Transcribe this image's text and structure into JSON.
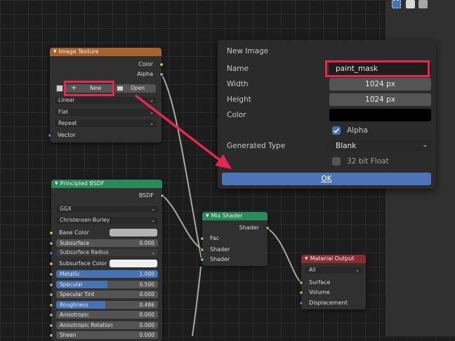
{
  "image_texture": {
    "title": "Image Texture",
    "out_color": "Color",
    "out_alpha": "Alpha",
    "new_label": "New",
    "open_label": "Open",
    "interpolation": "Linear",
    "projection": "Flat",
    "extension": "Repeat",
    "in_vector": "Vector"
  },
  "principled": {
    "title": "Principled BSDF",
    "out_bsdf": "BSDF",
    "distribution": "GGX",
    "subsurface_method": "Christensen-Burley",
    "base_color": "Base Color",
    "base_color_value": "#b4b4b4",
    "subsurface_color_value": "#f0f0f0",
    "subsurface_radius": "Subsurface Radius",
    "subsurface_color": "Subsurface Color",
    "fields": [
      {
        "label": "Subsurface",
        "value": "0.000",
        "fill": 0.0
      },
      {
        "label": "Metallic",
        "value": "1.000",
        "fill": 1.0
      },
      {
        "label": "Specular",
        "value": "0.500",
        "fill": 0.5
      },
      {
        "label": "Specular Tint",
        "value": "0.000",
        "fill": 0.0
      },
      {
        "label": "Roughness",
        "value": "0.486",
        "fill": 0.486
      },
      {
        "label": "Anisotropic",
        "value": "0.000",
        "fill": 0.0
      },
      {
        "label": "Anisotropic Rotation",
        "value": "0.000",
        "fill": 0.0
      },
      {
        "label": "Sheen",
        "value": "0.000",
        "fill": 0.0
      }
    ]
  },
  "mix_shader": {
    "title": "Mix Shader",
    "out_shader": "Shader",
    "fac": "Fac",
    "shader1": "Shader",
    "shader2": "Shader"
  },
  "material_output": {
    "title": "Material Output",
    "target": "All",
    "surface": "Surface",
    "volume": "Volume",
    "displacement": "Displacement"
  },
  "new_image": {
    "title": "New Image",
    "name_label": "Name",
    "name_value": "paint_mask",
    "width_label": "Width",
    "width_value": "1024 px",
    "height_label": "Height",
    "height_value": "1024 px",
    "color_label": "Color",
    "color_value": "#000000",
    "alpha_label": "Alpha",
    "alpha_checked": true,
    "generated_type_label": "Generated Type",
    "generated_type_value": "Blank",
    "float_label": "32 bit Float",
    "float_checked": false,
    "ok_label": "OK"
  },
  "colors": {
    "image_texture_header": "#a8622e",
    "principled_header": "#2a8a5a",
    "mix_header": "#2a8a5a",
    "output_header": "#8a2a32",
    "annotation": "#e8264e",
    "ok_button": "#4d74b8",
    "field_fill": "#4772b3"
  }
}
